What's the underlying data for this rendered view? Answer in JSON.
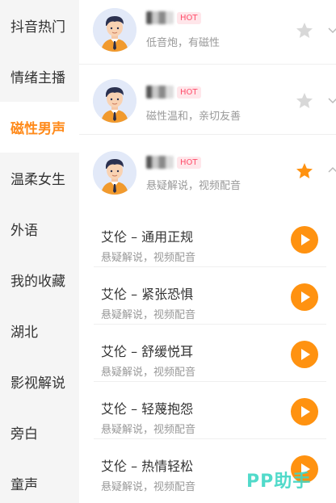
{
  "sidebar": {
    "items": [
      {
        "label": "抖音热门"
      },
      {
        "label": "情绪主播"
      },
      {
        "label": "磁性男声"
      },
      {
        "label": "温柔女生"
      },
      {
        "label": "外语"
      },
      {
        "label": "我的收藏"
      },
      {
        "label": "湖北"
      },
      {
        "label": "影视解说"
      },
      {
        "label": "旁白"
      },
      {
        "label": "童声"
      }
    ],
    "active_index": 2
  },
  "voices": [
    {
      "badge": "HOT",
      "desc": "低音炮，有磁性",
      "favorited": false
    },
    {
      "badge": "HOT",
      "desc": "磁性温和，亲切友善",
      "favorited": false
    },
    {
      "badge": "HOT",
      "desc": "悬疑解说，视频配音",
      "favorited": true
    }
  ],
  "sub_voices": [
    {
      "title": "艾伦 – 通用正规",
      "desc": "悬疑解说，视频配音"
    },
    {
      "title": "艾伦 – 紧张恐惧",
      "desc": "悬疑解说，视频配音"
    },
    {
      "title": "艾伦 – 舒缓悦耳",
      "desc": "悬疑解说，视频配音"
    },
    {
      "title": "艾伦 – 轻蔑抱怨",
      "desc": "悬疑解说，视频配音"
    },
    {
      "title": "艾伦 – 热情轻松",
      "desc": "悬疑解说，视频配音"
    }
  ],
  "watermark": "PP助手",
  "colors": {
    "accent": "#ff8a1a",
    "play": "#ff9210",
    "hot_text": "#ff4d6a",
    "hot_bg": "#ffe6ea",
    "star_off": "#d8d8d8",
    "star_on": "#ff9210"
  },
  "icons": {
    "favorite": "star-icon",
    "expand": "chevron-icon",
    "play": "play-icon"
  }
}
